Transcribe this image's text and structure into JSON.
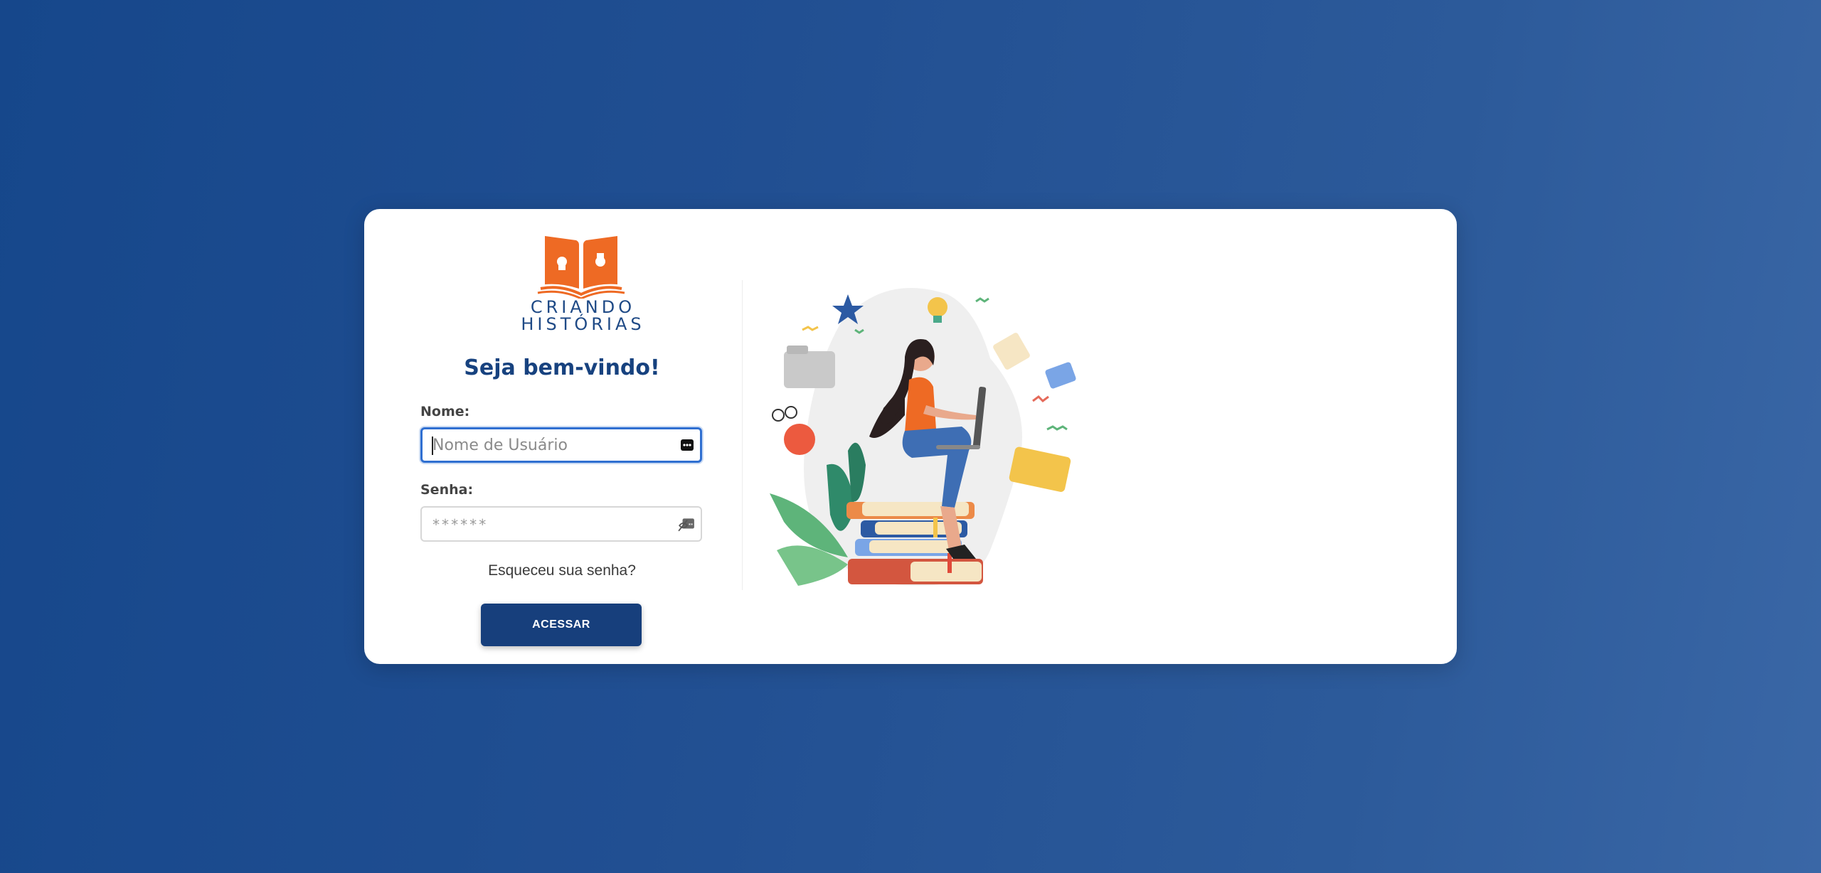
{
  "brand": {
    "line1": "CRIANDO",
    "line2": "HISTÓRIAS",
    "logo_icon": "open-book-puzzle-icon",
    "color_primary": "#1f4a86",
    "color_logo": "#ee6a24"
  },
  "login": {
    "welcome": "Seja bem-vindo!",
    "name_label": "Nome:",
    "name_placeholder": "Nome de Usuário",
    "name_value": "",
    "password_label": "Senha:",
    "password_mask": "******",
    "forgot_link": "Esqueceu sua senha?",
    "submit_label": "ACESSAR",
    "button_color": "#173f7c"
  },
  "illustration": {
    "icon": "woman-reading-on-books-illustration"
  },
  "background": {
    "gradient_start": "#16478b",
    "gradient_end": "#3a67a6"
  }
}
